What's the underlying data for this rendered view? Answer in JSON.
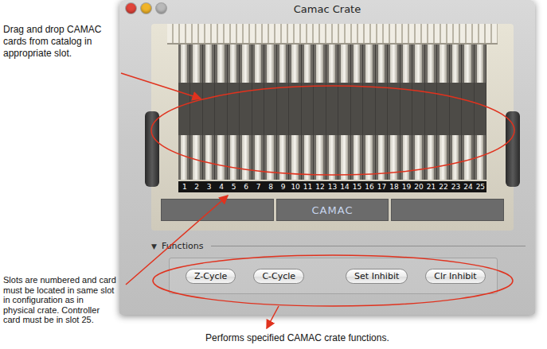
{
  "window": {
    "title": "Camac Crate",
    "buttons": [
      {
        "name": "close",
        "color": "#e0443a"
      },
      {
        "name": "minimize",
        "color": "#f0b429"
      },
      {
        "name": "zoom",
        "color": "#b9b9b9"
      }
    ]
  },
  "crate": {
    "slots": [
      "1",
      "2",
      "3",
      "4",
      "5",
      "6",
      "7",
      "8",
      "9",
      "10",
      "11",
      "12",
      "13",
      "14",
      "15",
      "16",
      "17",
      "18",
      "19",
      "20",
      "21",
      "22",
      "23",
      "24",
      "25"
    ],
    "label": "CAMAC"
  },
  "functions": {
    "toggle": "▼",
    "label": "Functions",
    "expanded": true,
    "buttons": [
      "Z-Cycle",
      "C-Cycle",
      "Set Inhibit",
      "Clr Inhibit"
    ]
  },
  "annotations": [
    {
      "text": "Drag and drop CAMAC cards from catalog in appropriate slot."
    },
    {
      "text": "Slots are numbered and card must be located in same slot in configuration as in physical crate.  Controller card must be in slot 25."
    },
    {
      "text": "Performs specified CAMAC crate functions."
    }
  ]
}
